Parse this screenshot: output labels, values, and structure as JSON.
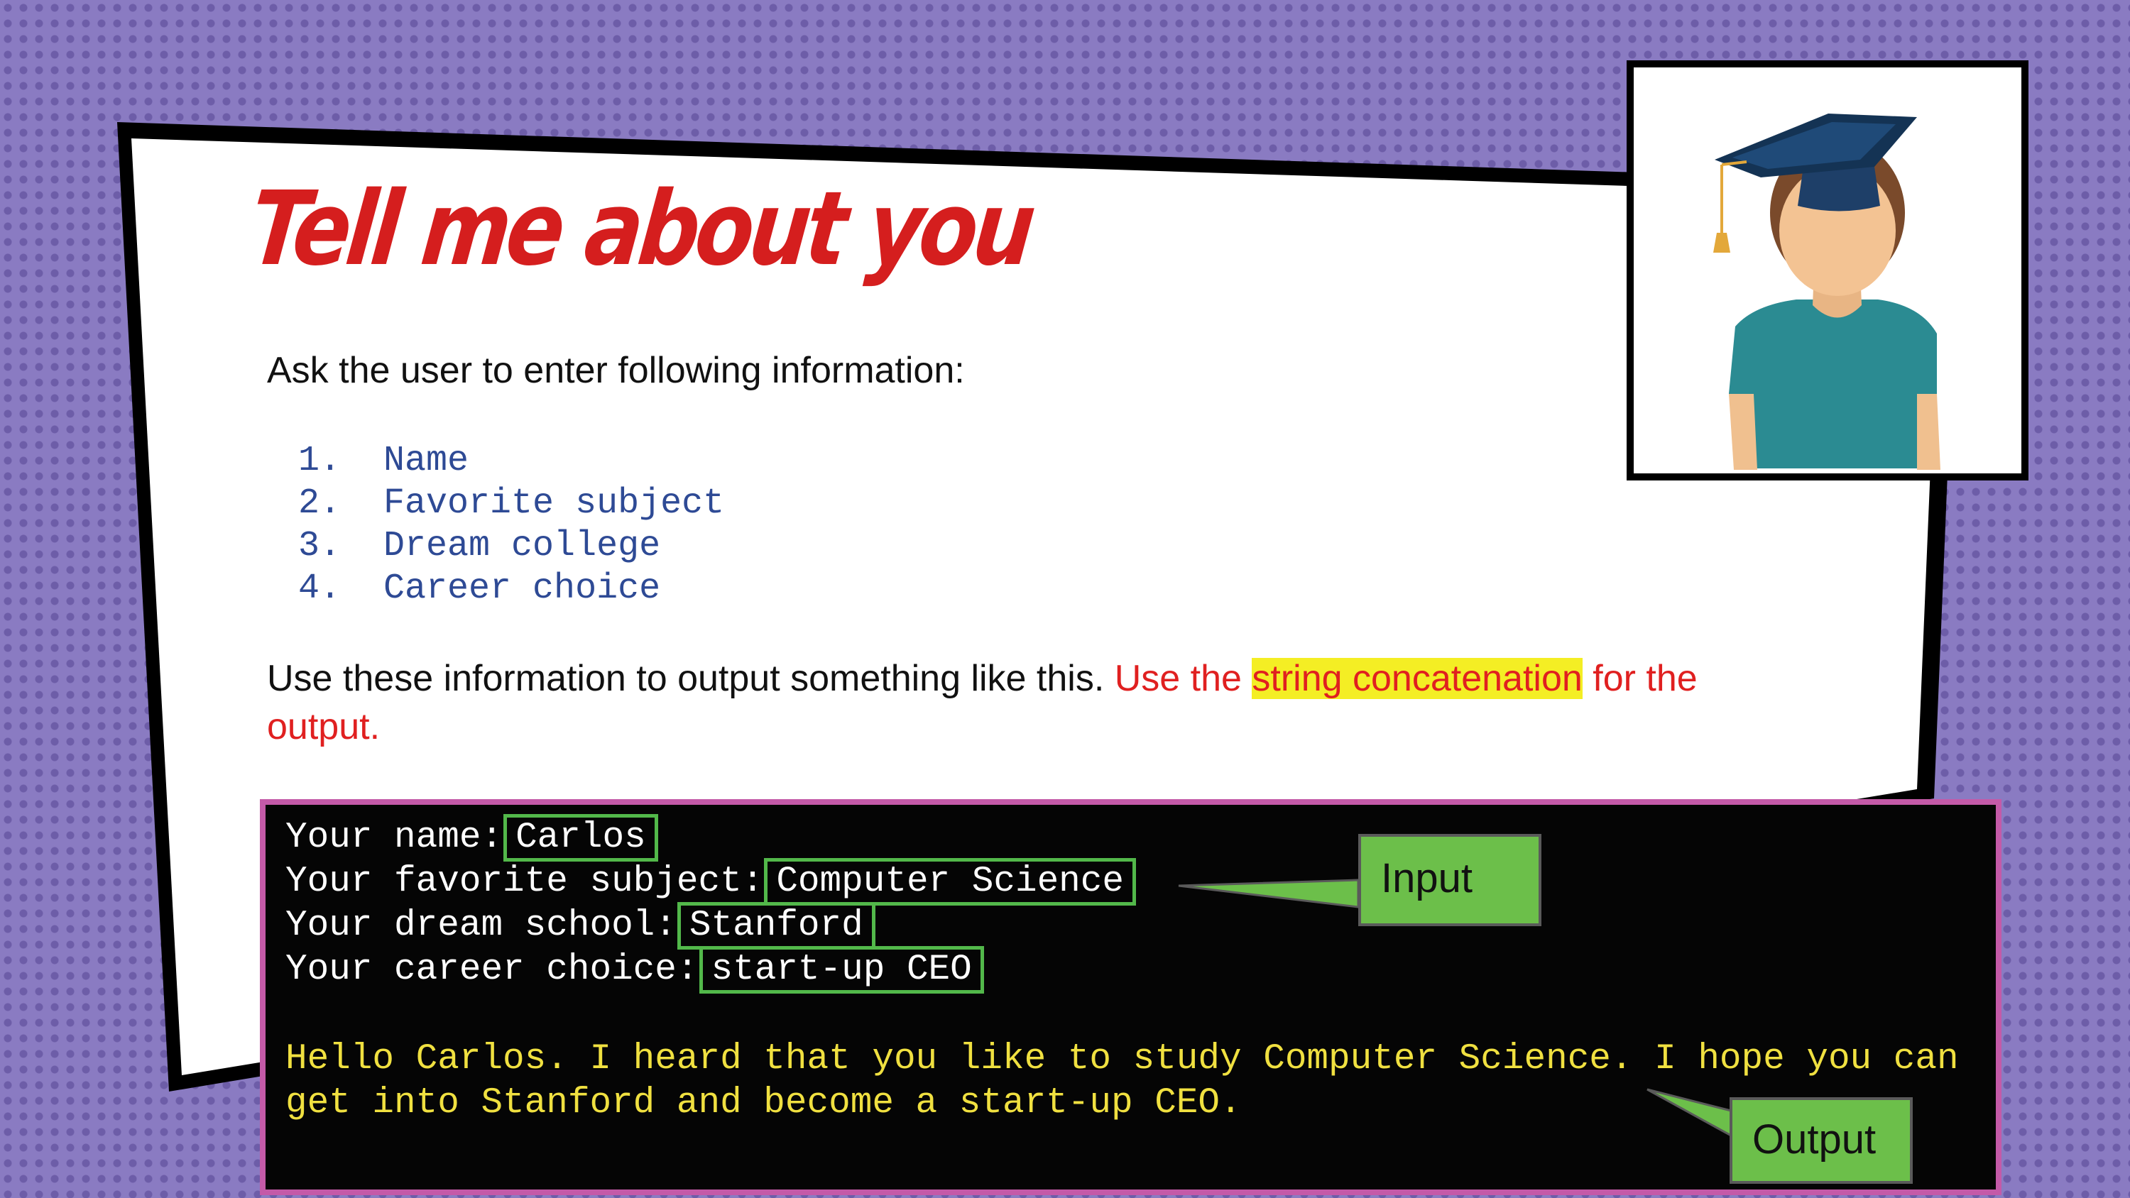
{
  "title": "Tell me about you",
  "intro": "Ask the user to enter following information:",
  "fields": [
    "1.  Name",
    "2.  Favorite subject",
    "3.  Dream college",
    "4.  Career choice"
  ],
  "instruction": {
    "black": "Use these information to output something like this. ",
    "red_start": "Use the ",
    "highlight": "string concatenation",
    "red_end": " for the output."
  },
  "terminal": {
    "lines": [
      {
        "prompt": "Your name:",
        "value": "Carlos"
      },
      {
        "prompt": "Your favorite subject:",
        "value": "Computer Science"
      },
      {
        "prompt": "Your dream school:",
        "value": "Stanford"
      },
      {
        "prompt": "Your career choice:",
        "value": "start-up CEO"
      }
    ],
    "output": "Hello Carlos. I heard that you like to study Computer Science. I hope you can get into Stanford and become a start-up CEO."
  },
  "callouts": {
    "input": "Input",
    "output": "Output"
  },
  "colors": {
    "background": "#8a7bc2",
    "title": "#d51e1e",
    "list": "#2e4a95",
    "terminal_bg": "#050505",
    "terminal_border": "#c45aa8",
    "box_green": "#52b84a",
    "output_text": "#f0e040",
    "callout_green": "#6cbf4a",
    "highlight": "#f4ee24"
  },
  "illustration": "graduate-avatar-icon"
}
